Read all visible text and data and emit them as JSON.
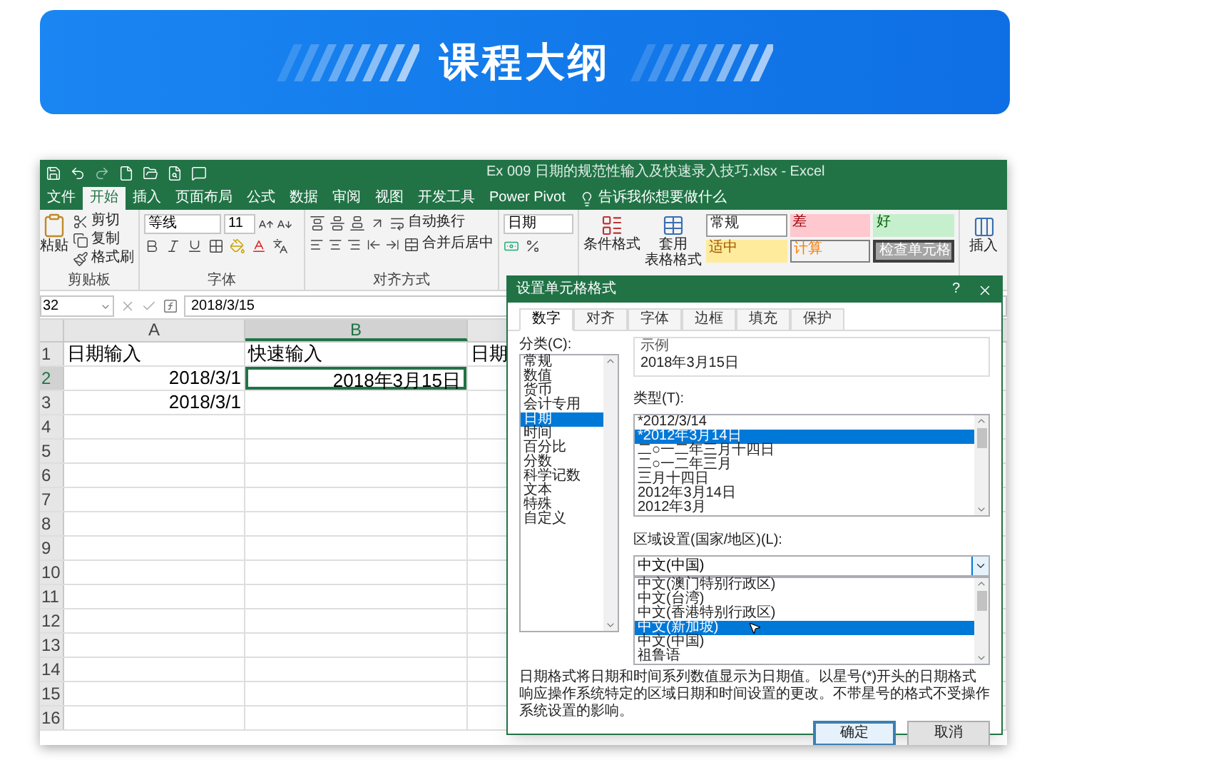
{
  "header": {
    "title": "课程大纲"
  },
  "excel": {
    "window_title": "Ex 009 日期的规范性输入及快速录入技巧.xlsx - Excel",
    "tabs": [
      {
        "label": "文件",
        "selected": false
      },
      {
        "label": "开始",
        "selected": true
      },
      {
        "label": "插入",
        "selected": false
      },
      {
        "label": "页面布局",
        "selected": false
      },
      {
        "label": "公式",
        "selected": false
      },
      {
        "label": "数据",
        "selected": false
      },
      {
        "label": "审阅",
        "selected": false
      },
      {
        "label": "视图",
        "selected": false
      },
      {
        "label": "开发工具",
        "selected": false
      },
      {
        "label": "Power Pivot",
        "selected": false
      }
    ],
    "tell_me": "告诉我你想要做什么",
    "ribbon": {
      "clipboard": {
        "paste": "粘贴",
        "cut": "剪切",
        "copy": "复制",
        "format_painter": "格式刷",
        "label": "剪贴板"
      },
      "font": {
        "name": "等线",
        "size": "11",
        "label": "字体"
      },
      "alignment": {
        "wrap": "自动换行",
        "merge": "合并后居中",
        "label": "对齐方式"
      },
      "number": {
        "format": "日期"
      },
      "styles": {
        "conditional": "条件格式",
        "table_line_1": "套用",
        "table_line_2": "表格格式",
        "cells": [
          {
            "label": "常规",
            "kind": "normal"
          },
          {
            "label": "差",
            "kind": "bad"
          },
          {
            "label": "好",
            "kind": "good"
          },
          {
            "label": "适中",
            "kind": "neutral"
          },
          {
            "label": "计算",
            "kind": "calculation"
          },
          {
            "label": "检查单元格",
            "kind": "check"
          }
        ]
      },
      "insert": "插入"
    },
    "formula_bar": {
      "name_box": "32",
      "value": "2018/3/15"
    },
    "columns": [
      {
        "label": "A",
        "selected": false
      },
      {
        "label": "B",
        "selected": true
      }
    ],
    "rows": [
      {
        "number": "1",
        "selected": false,
        "cells": [
          {
            "text": "日期输入",
            "kind": "text",
            "selected": false
          },
          {
            "text": "快速输入",
            "kind": "text",
            "selected": false
          },
          {
            "text": "日期",
            "kind": "text",
            "selected": false
          }
        ]
      },
      {
        "number": "2",
        "selected": true,
        "cells": [
          {
            "text": "2018/3/1",
            "kind": "number",
            "selected": false
          },
          {
            "text": "2018年3月15日",
            "kind": "number",
            "selected": true
          }
        ]
      },
      {
        "number": "3",
        "selected": false,
        "cells": [
          {
            "text": "2018/3/1",
            "kind": "number",
            "selected": false
          }
        ]
      },
      {
        "number": "4",
        "selected": false
      },
      {
        "number": "5",
        "selected": false
      },
      {
        "number": "6",
        "selected": false
      },
      {
        "number": "7",
        "selected": false
      },
      {
        "number": "8",
        "selected": false
      },
      {
        "number": "9",
        "selected": false
      },
      {
        "number": "10",
        "selected": false
      },
      {
        "number": "11",
        "selected": false
      },
      {
        "number": "12",
        "selected": false
      },
      {
        "number": "13",
        "selected": false
      },
      {
        "number": "14",
        "selected": false
      },
      {
        "number": "15",
        "selected": false
      },
      {
        "number": "16",
        "selected": false
      }
    ],
    "dialog": {
      "title": "设置单元格格式",
      "help": "?",
      "tabs": [
        {
          "label": "数字",
          "selected": true
        },
        {
          "label": "对齐",
          "selected": false
        },
        {
          "label": "字体",
          "selected": false
        },
        {
          "label": "边框",
          "selected": false
        },
        {
          "label": "填充",
          "selected": false
        },
        {
          "label": "保护",
          "selected": false
        }
      ],
      "category_label": "分类(C):",
      "categories": [
        {
          "label": "常规",
          "selected": false
        },
        {
          "label": "数值",
          "selected": false
        },
        {
          "label": "货币",
          "selected": false
        },
        {
          "label": "会计专用",
          "selected": false
        },
        {
          "label": "日期",
          "selected": true
        },
        {
          "label": "时间",
          "selected": false
        },
        {
          "label": "百分比",
          "selected": false
        },
        {
          "label": "分数",
          "selected": false
        },
        {
          "label": "科学记数",
          "selected": false
        },
        {
          "label": "文本",
          "selected": false
        },
        {
          "label": "特殊",
          "selected": false
        },
        {
          "label": "自定义",
          "selected": false
        }
      ],
      "sample_label": "示例",
      "sample": "2018年3月15日",
      "type_label": "类型(T):",
      "types": [
        {
          "label": "*2012/3/14",
          "selected": false
        },
        {
          "label": "*2012年3月14日",
          "selected": true
        },
        {
          "label": "二○一二年三月十四日",
          "selected": false
        },
        {
          "label": "二○一二年三月",
          "selected": false
        },
        {
          "label": "三月十四日",
          "selected": false
        },
        {
          "label": "2012年3月14日",
          "selected": false
        },
        {
          "label": "2012年3月",
          "selected": false
        }
      ],
      "locale_label": "区域设置(国家/地区)(L):",
      "locale_value": "中文(中国)",
      "locales": [
        {
          "label": "中文(澳门特别行政区)",
          "selected": false
        },
        {
          "label": "中文(台湾)",
          "selected": false
        },
        {
          "label": "中文(香港特别行政区)",
          "selected": false
        },
        {
          "label": "中文(新加坡)",
          "selected": true
        },
        {
          "label": "中文(中国)",
          "selected": false
        },
        {
          "label": "祖鲁语",
          "selected": false
        }
      ],
      "description": "日期格式将日期和时间系列数值显示为日期值。以星号(*)开头的日期格式响应操作系统特定的区域日期和时间设置的更改。不带星号的格式不受操作系统设置的影响。",
      "buttons": [
        {
          "label": "确定",
          "kind": "primary"
        },
        {
          "label": "取消",
          "kind": "secondary"
        }
      ]
    }
  }
}
